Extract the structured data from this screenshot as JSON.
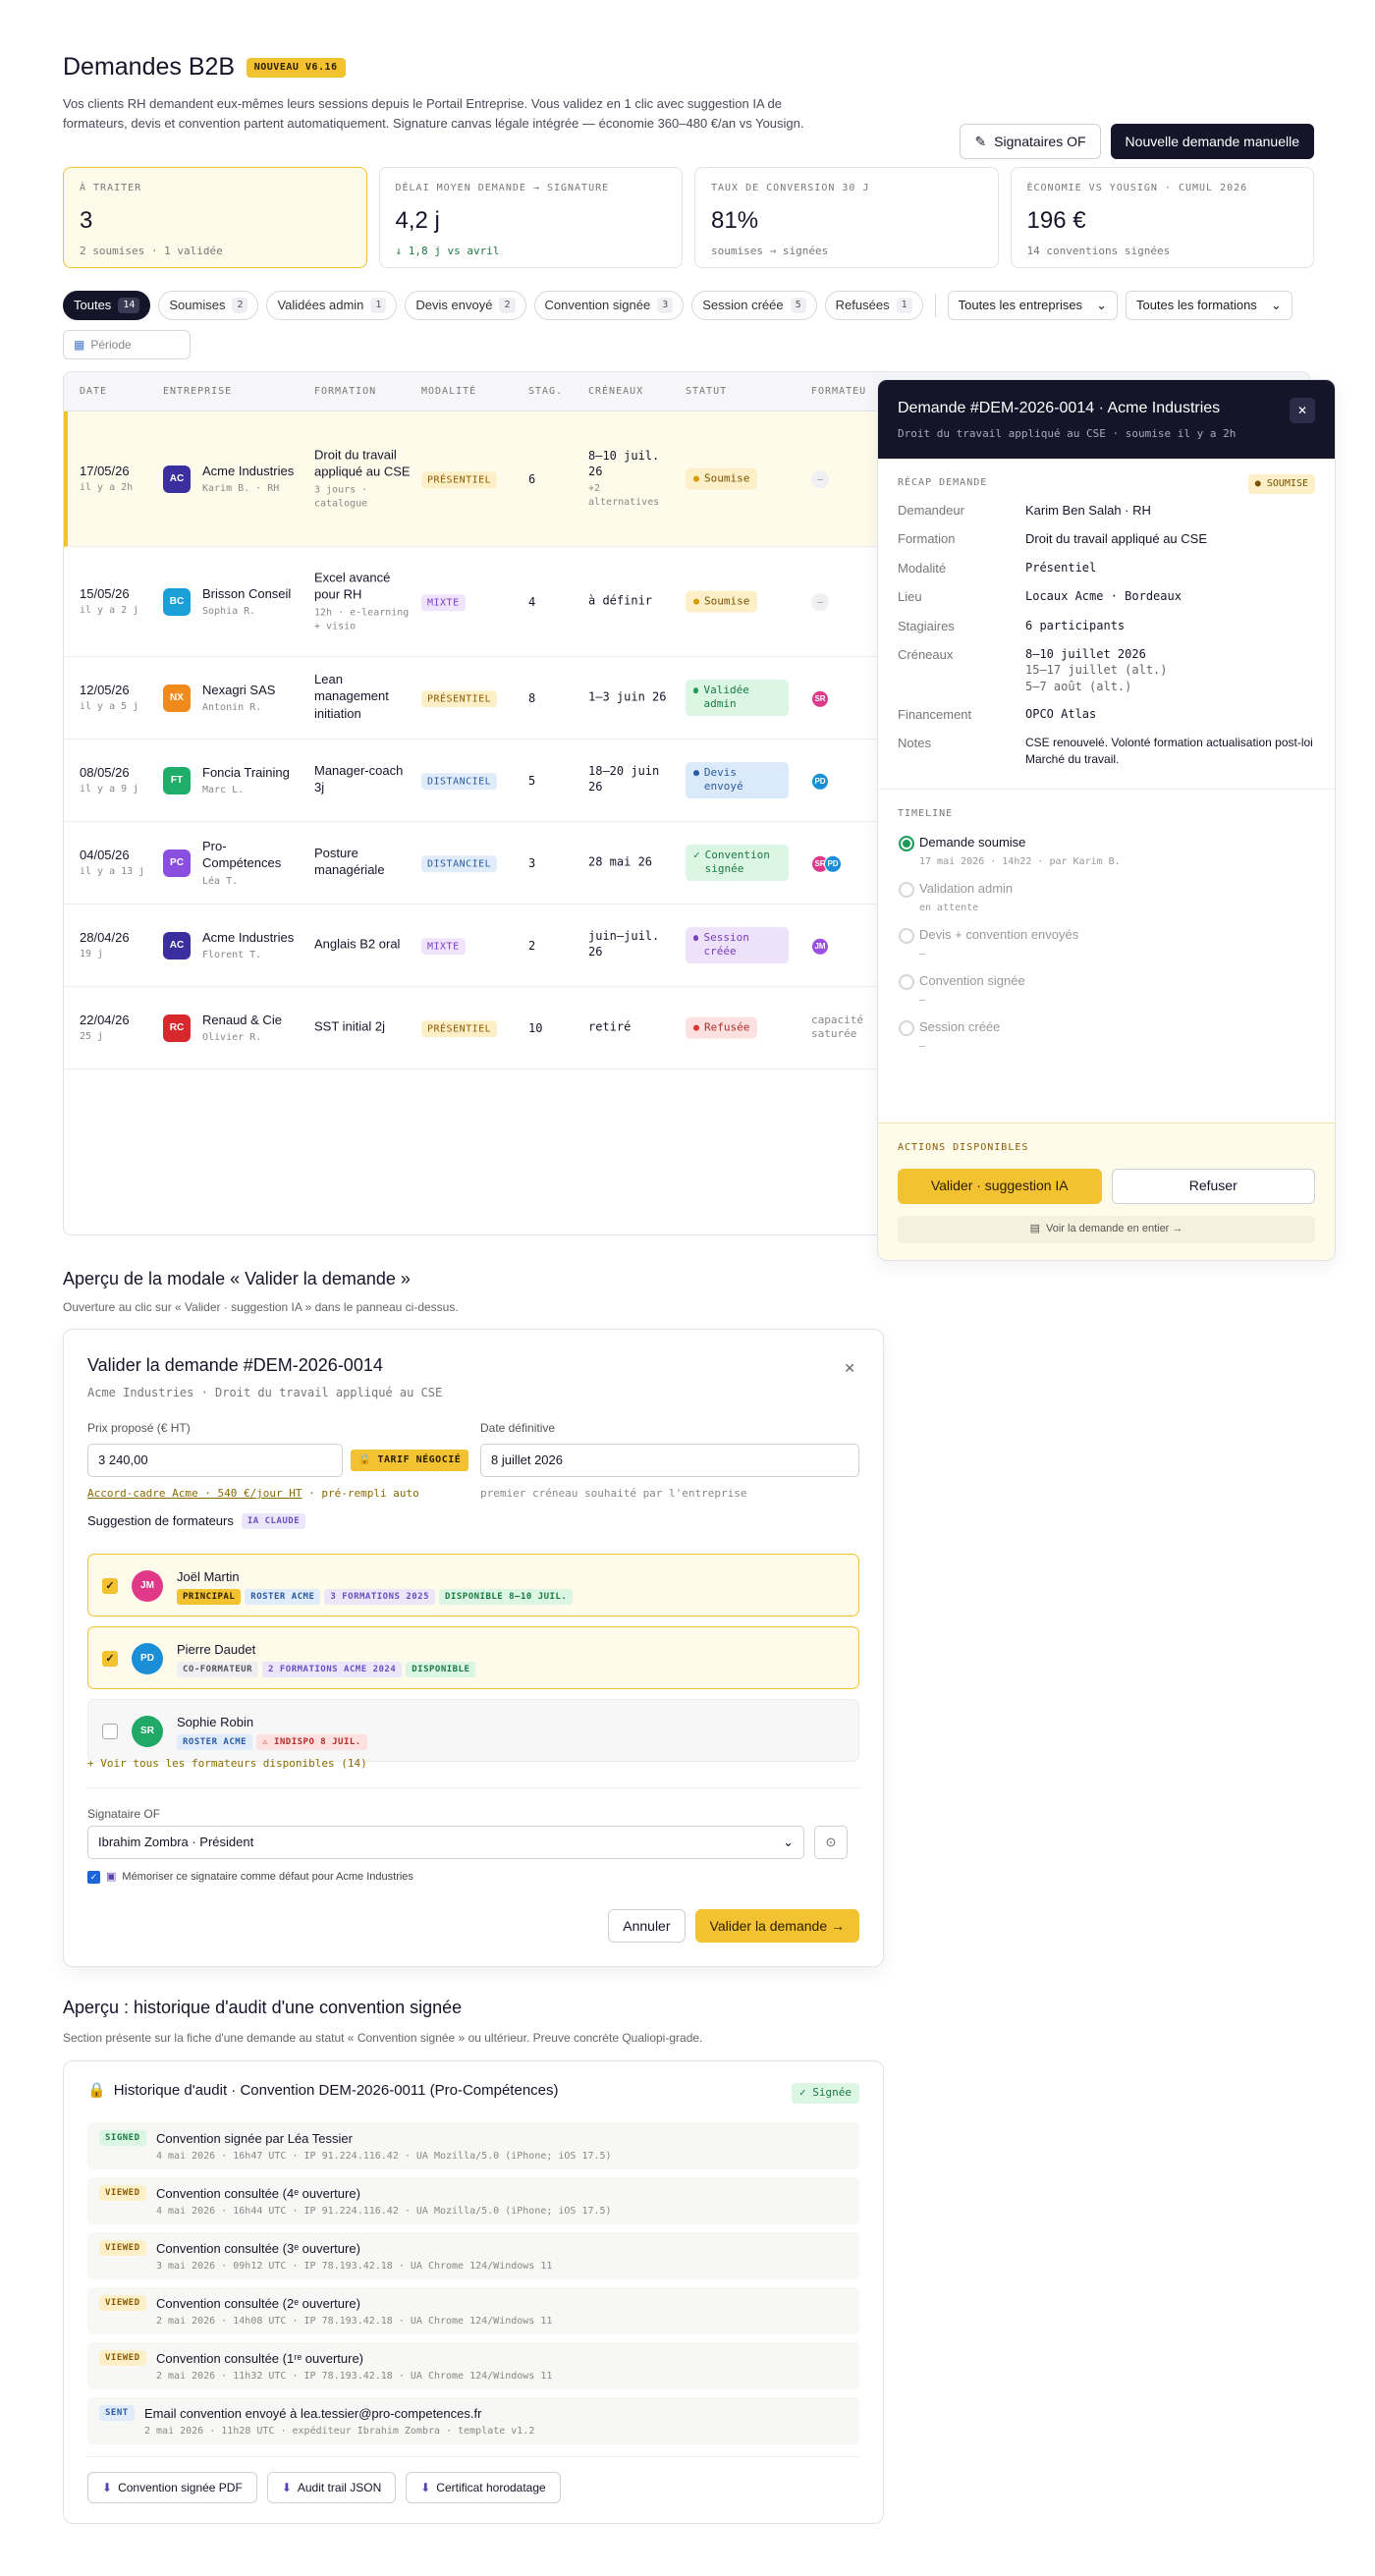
{
  "header": {
    "title": "Demandes B2B",
    "version": "NOUVEAU V6.16",
    "subtitle": "Vos clients RH demandent eux-mêmes leurs sessions depuis le Portail Entreprise. Vous validez en 1 clic avec suggestion IA de formateurs, devis et convention partent automatiquement. Signature canvas légale intégrée — économie 360–480 €/an vs Yousign.",
    "btn_signataires": "Signataires OF",
    "btn_new": "Nouvelle demande manuelle"
  },
  "kpis": [
    {
      "label": "À TRAITER",
      "value": "3",
      "meta": "2 soumises · 1 validée"
    },
    {
      "label": "DÉLAI MOYEN DEMANDE → SIGNATURE",
      "value": "4,2 j",
      "meta": "↓ 1,8 j vs avril"
    },
    {
      "label": "TAUX DE CONVERSION 30 J",
      "value": "81%",
      "meta": "soumises → signées"
    },
    {
      "label": "ÉCONOMIE VS YOUSIGN · CUMUL 2026",
      "value": "196 €",
      "meta": "14 conventions signées"
    }
  ],
  "filters": {
    "chips": [
      {
        "label": "Toutes",
        "count": "14"
      },
      {
        "label": "Soumises",
        "count": "2"
      },
      {
        "label": "Validées admin",
        "count": "1"
      },
      {
        "label": "Devis envoyé",
        "count": "2"
      },
      {
        "label": "Convention signée",
        "count": "3"
      },
      {
        "label": "Session créée",
        "count": "5"
      },
      {
        "label": "Refusées",
        "count": "1"
      }
    ],
    "select_entreprises": "Toutes les entreprises",
    "select_formations": "Toutes les formations",
    "period_placeholder": "Période"
  },
  "table": {
    "headers": [
      "DATE",
      "ENTREPRISE",
      "FORMATION",
      "MODALITÉ",
      "STAG.",
      "CRÉNEAUX",
      "STATUT",
      "FORMATEU"
    ],
    "rows": [
      {
        "date": "17/05/26",
        "ago": "il y a 2h",
        "initials": "AC",
        "color": "#3b2fa0",
        "company": "Acme Industries",
        "contact": "Karim B. · RH",
        "formation": "Droit du travail appliqué au CSE",
        "fmeta": "3 jours · catalogue",
        "modalite": "PRÉSENTIEL",
        "mod": "pres",
        "stag": "6",
        "creneau": "8–10 juil. 26",
        "cmeta": "+2 alternatives",
        "statut": "Soumise",
        "st": "sou",
        "trainer": "–"
      },
      {
        "date": "15/05/26",
        "ago": "il y a 2 j",
        "initials": "BC",
        "color": "#1aa0d8",
        "company": "Brisson Conseil",
        "contact": "Sophia R.",
        "formation": "Excel avancé pour RH",
        "fmeta": "12h · e-learning + visio",
        "modalite": "MIXTE",
        "mod": "mix",
        "stag": "4",
        "creneau": "à définir",
        "cmeta": "",
        "statut": "Soumise",
        "st": "sou",
        "trainer": "–"
      },
      {
        "date": "12/05/26",
        "ago": "il y a 5 j",
        "initials": "NX",
        "color": "#f08a1a",
        "company": "Nexagri SAS",
        "contact": "Antonin R.",
        "formation": "Lean management initiation",
        "fmeta": "",
        "modalite": "PRÉSENTIEL",
        "mod": "pres",
        "stag": "8",
        "creneau": "1–3 juin 26",
        "cmeta": "",
        "statut": "Validée admin",
        "st": "val",
        "trainer": "SR"
      },
      {
        "date": "08/05/26",
        "ago": "il y a 9 j",
        "initials": "FT",
        "color": "#1fae6a",
        "company": "Foncia Training",
        "contact": "Marc L.",
        "formation": "Manager-coach 3j",
        "fmeta": "",
        "modalite": "DISTANCIEL",
        "mod": "dist",
        "stag": "5",
        "creneau": "18–20 juin 26",
        "cmeta": "",
        "statut": "Devis envoyé",
        "st": "dev",
        "trainer": "PD"
      },
      {
        "date": "04/05/26",
        "ago": "il y a 13 j",
        "initials": "PC",
        "color": "#8a4fe0",
        "company": "Pro-Compétences",
        "contact": "Léa T.",
        "formation": "Posture managériale",
        "fmeta": "",
        "modalite": "DISTANCIEL",
        "mod": "dist",
        "stag": "3",
        "creneau": "28 mai 26",
        "cmeta": "",
        "statut": "Convention signée",
        "st": "con",
        "trainer": "SR PD"
      },
      {
        "date": "28/04/26",
        "ago": "19 j",
        "initials": "AC",
        "color": "#3b2fa0",
        "company": "Acme Industries",
        "contact": "Florent T.",
        "formation": "Anglais B2 oral",
        "fmeta": "",
        "modalite": "MIXTE",
        "mod": "mix",
        "stag": "2",
        "creneau": "juin–juil. 26",
        "cmeta": "",
        "statut": "Session créée",
        "st": "ses",
        "trainer": "JM"
      },
      {
        "date": "22/04/26",
        "ago": "25 j",
        "initials": "RC",
        "color": "#d8282e",
        "company": "Renaud & Cie",
        "contact": "Olivier R.",
        "formation": "SST initial 2j",
        "fmeta": "",
        "modalite": "PRÉSENTIEL",
        "mod": "pres",
        "stag": "10",
        "creneau": "retiré",
        "cmeta": "",
        "statut": "Refusée",
        "st": "ref",
        "trainer": "capacité saturée"
      }
    ]
  },
  "panel": {
    "title": "Demande #DEM-2026-0014 · Acme Industries",
    "subtitle": "Droit du travail appliqué au CSE · soumise il y a 2h",
    "recap_label": "RÉCAP DEMANDE",
    "recap_badge": "SOUMISE",
    "recap": [
      {
        "k": "Demandeur",
        "v": "Karim Ben Salah · RH"
      },
      {
        "k": "Formation",
        "v": "Droit du travail appliqué au CSE"
      },
      {
        "k": "Modalité",
        "v": "Présentiel"
      },
      {
        "k": "Lieu",
        "v": "Locaux Acme · Bordeaux"
      },
      {
        "k": "Stagiaires",
        "v": "6 participants"
      }
    ],
    "creneaux_k": "Créneaux",
    "creneaux": [
      "8–10 juillet 2026",
      "15–17 juillet (alt.)",
      "5–7 août (alt.)"
    ],
    "financement_k": "Financement",
    "financement_v": "OPCO Atlas",
    "notes_k": "Notes",
    "notes_v": "CSE renouvelé. Volonté formation actualisation post-loi Marché du travail.",
    "timeline_label": "TIMELINE",
    "timeline": [
      {
        "a": "Demande soumise",
        "b": "17 mai 2026 · 14h22 · par Karim B."
      },
      {
        "a": "Validation admin",
        "b": "en attente"
      },
      {
        "a": "Devis + convention envoyés",
        "b": "–"
      },
      {
        "a": "Convention signée",
        "b": "–"
      },
      {
        "a": "Session créée",
        "b": "–"
      }
    ],
    "actions_label": "ACTIONS DISPONIBLES",
    "btn_validate": "Valider · suggestion IA",
    "btn_refuse": "Refuser",
    "link_full": "Voir la demande en entier →"
  },
  "modal_section": {
    "title": "Aperçu de la modale « Valider la demande »",
    "subtitle": "Ouverture au clic sur « Valider · suggestion IA » dans le panneau ci-dessus."
  },
  "modal": {
    "title": "Valider la demande #DEM-2026-0014",
    "subtitle": "Acme Industries · Droit du travail appliqué au CSE",
    "price_label": "Prix proposé (€ HT)",
    "price_value": "3 240,00",
    "price_tag": "TARIF NÉGOCIÉ",
    "price_hint_link": "Accord-cadre Acme · 540 €/jour HT",
    "price_hint_rest": " · pré-rempli auto",
    "date_label": "Date définitive",
    "date_value": "8 juillet 2026",
    "date_hint": "premier créneau souhaité par l'entreprise",
    "trainers_label": "Suggestion de formateurs",
    "trainers_tag": "IA CLAUDE",
    "trainers": [
      {
        "initials": "JM",
        "color": "#e0398a",
        "name": "Joël Martin",
        "tags": [
          [
            "PRINCIPAL",
            "y"
          ],
          [
            "ROSTER ACME",
            "b"
          ],
          [
            "3 FORMATIONS 2025",
            "p"
          ],
          [
            "DISPONIBLE 8–10 JUIL.",
            "g"
          ]
        ]
      },
      {
        "initials": "PD",
        "color": "#1a8fd8",
        "name": "Pierre Daudet",
        "tags": [
          [
            "CO-FORMATEUR",
            "gr"
          ],
          [
            "2 FORMATIONS ACME 2024",
            "p"
          ],
          [
            "DISPONIBLE",
            "g"
          ]
        ]
      },
      {
        "initials": "SR",
        "color": "#1fa866",
        "name": "Sophie Robin",
        "tags": [
          [
            "ROSTER ACME",
            "b"
          ],
          [
            "⚠ INDISPO 8 JUIL.",
            "r"
          ]
        ]
      }
    ],
    "more_link": "+ Voir tous les formateurs disponibles (14)",
    "signataire_label": "Signataire OF",
    "signataire_value": "Ibrahim Zombra · Président",
    "remember_label": "Mémoriser ce signataire comme défaut pour Acme Industries",
    "btn_cancel": "Annuler",
    "btn_confirm": "Valider la demande →"
  },
  "audit_section": {
    "title": "Aperçu : historique d'audit d'une convention signée",
    "subtitle": "Section présente sur la fiche d'une demande au statut « Convention signée » ou ultérieur. Preuve concrète Qualiopi-grade."
  },
  "audit": {
    "title": "Historique d'audit · Convention DEM-2026-0011 (Pro-Compétences)",
    "badge": "✓ Signée",
    "events": [
      {
        "tag": "SIGNED",
        "kind": "s",
        "text": "Convention signée par Léa Tessier",
        "meta": "4 mai 2026 · 16h47 UTC · IP 91.224.116.42 · UA Mozilla/5.0 (iPhone; iOS 17.5)"
      },
      {
        "tag": "VIEWED",
        "kind": "v",
        "text": "Convention consultée (4ᵉ ouverture)",
        "meta": "4 mai 2026 · 16h44 UTC · IP 91.224.116.42 · UA Mozilla/5.0 (iPhone; iOS 17.5)"
      },
      {
        "tag": "VIEWED",
        "kind": "v",
        "text": "Convention consultée (3ᵉ ouverture)",
        "meta": "3 mai 2026 · 09h12 UTC · IP 78.193.42.18 · UA Chrome 124/Windows 11"
      },
      {
        "tag": "VIEWED",
        "kind": "v",
        "text": "Convention consultée (2ᵉ ouverture)",
        "meta": "2 mai 2026 · 14h08 UTC · IP 78.193.42.18 · UA Chrome 124/Windows 11"
      },
      {
        "tag": "VIEWED",
        "kind": "v",
        "text": "Convention consultée (1ʳᵉ ouverture)",
        "meta": "2 mai 2026 · 11h32 UTC · IP 78.193.42.18 · UA Chrome 124/Windows 11"
      },
      {
        "tag": "SENT",
        "kind": "e",
        "text": "Email convention envoyé à lea.tessier@pro-competences.fr",
        "meta": "2 mai 2026 · 11h28 UTC · expéditeur Ibrahim Zombra · template v1.2"
      }
    ],
    "btns": [
      "Convention signée PDF",
      "Audit trail JSON",
      "Certificat horodatage"
    ]
  }
}
